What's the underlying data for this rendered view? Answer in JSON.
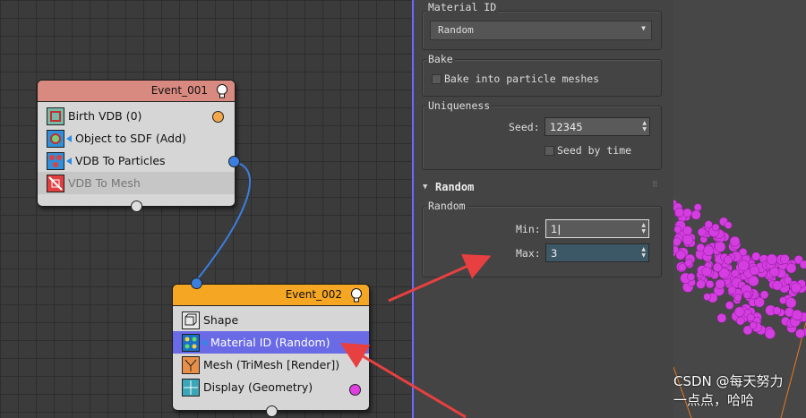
{
  "nodes": {
    "event1": {
      "title": "Event_001",
      "operators": [
        {
          "label": "Birth VDB (0)",
          "icon": "birth-vdb-icon"
        },
        {
          "label": "Object to SDF (Add)",
          "icon": "object-to-sdf-icon"
        },
        {
          "label": "VDB To Particles",
          "icon": "vdb-to-particles-icon"
        },
        {
          "label": "VDB To Mesh",
          "icon": "vdb-to-mesh-icon"
        }
      ]
    },
    "event2": {
      "title": "Event_002",
      "operators": [
        {
          "label": "Shape",
          "icon": "shape-icon"
        },
        {
          "label": "Material ID (Random)",
          "icon": "material-id-icon"
        },
        {
          "label": "Mesh (TriMesh [Render])",
          "icon": "mesh-icon"
        },
        {
          "label": "Display (Geometry)",
          "icon": "display-icon"
        }
      ]
    }
  },
  "panel": {
    "material_id": {
      "label": "Material ID",
      "value": "Random"
    },
    "bake": {
      "label": "Bake",
      "checkbox_label": "Bake into particle meshes"
    },
    "uniqueness": {
      "label": "Uniqueness",
      "seed_label": "Seed:",
      "seed_value": "12345",
      "seed_by_time_label": "Seed by time"
    },
    "random_section": {
      "title": "Random",
      "group_label": "Random",
      "min_label": "Min:",
      "min_value": "1",
      "max_label": "Max:",
      "max_value": "3"
    }
  },
  "watermark": "CSDN @每天努力一点点，哈哈",
  "colors": {
    "event1_header": "#d98a80",
    "event2_header": "#f5a623",
    "selected_row": "#6a6ae6",
    "particles": "#d43de0",
    "arrow": "#e84040"
  }
}
